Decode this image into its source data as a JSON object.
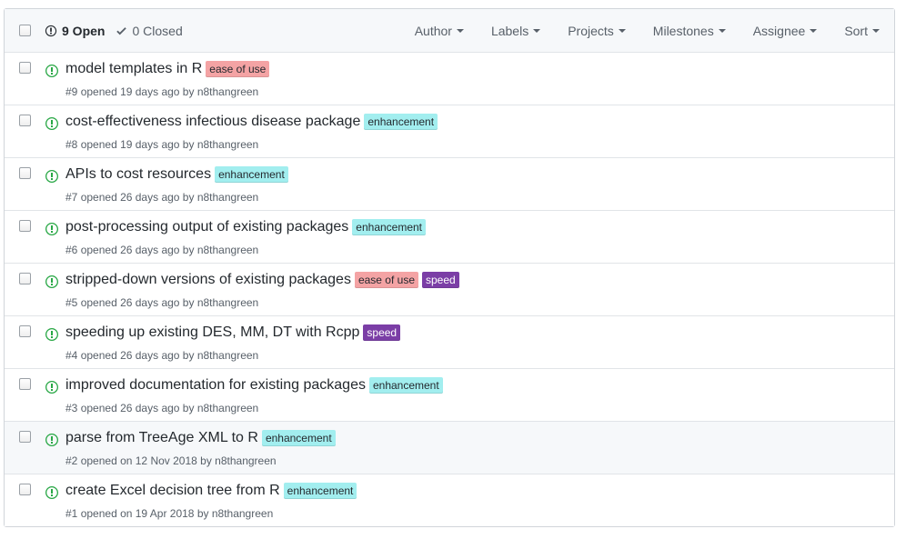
{
  "header": {
    "open_label": "9 Open",
    "closed_label": "0 Closed",
    "filters": [
      "Author",
      "Labels",
      "Projects",
      "Milestones",
      "Assignee",
      "Sort"
    ]
  },
  "label_colors": {
    "ease of use": {
      "bg": "#f4a3a4",
      "fg": "#24292e"
    },
    "enhancement": {
      "bg": "#a2eeef",
      "fg": "#24292e"
    },
    "speed": {
      "bg": "#7b3ea6",
      "fg": "#ffffff"
    }
  },
  "icon_color": "#28a745",
  "issues": [
    {
      "title": "model templates in R",
      "labels": [
        "ease of use"
      ],
      "number": "#9",
      "opened": "opened 19 days ago by",
      "author": "n8thangreen"
    },
    {
      "title": "cost-effectiveness infectious disease package",
      "labels": [
        "enhancement"
      ],
      "number": "#8",
      "opened": "opened 19 days ago by",
      "author": "n8thangreen"
    },
    {
      "title": "APIs to cost resources",
      "labels": [
        "enhancement"
      ],
      "number": "#7",
      "opened": "opened 26 days ago by",
      "author": "n8thangreen"
    },
    {
      "title": "post-processing output of existing packages",
      "labels": [
        "enhancement"
      ],
      "number": "#6",
      "opened": "opened 26 days ago by",
      "author": "n8thangreen"
    },
    {
      "title": "stripped-down versions of existing packages",
      "labels": [
        "ease of use",
        "speed"
      ],
      "number": "#5",
      "opened": "opened 26 days ago by",
      "author": "n8thangreen"
    },
    {
      "title": "speeding up existing DES, MM, DT with Rcpp",
      "labels": [
        "speed"
      ],
      "number": "#4",
      "opened": "opened 26 days ago by",
      "author": "n8thangreen"
    },
    {
      "title": "improved documentation for existing packages",
      "labels": [
        "enhancement"
      ],
      "number": "#3",
      "opened": "opened 26 days ago by",
      "author": "n8thangreen"
    },
    {
      "title": "parse from TreeAge XML to R",
      "labels": [
        "enhancement"
      ],
      "number": "#2",
      "opened": "opened on 12 Nov 2018 by",
      "author": "n8thangreen",
      "hover": true
    },
    {
      "title": "create Excel decision tree from R",
      "labels": [
        "enhancement"
      ],
      "number": "#1",
      "opened": "opened on 19 Apr 2018 by",
      "author": "n8thangreen"
    }
  ]
}
